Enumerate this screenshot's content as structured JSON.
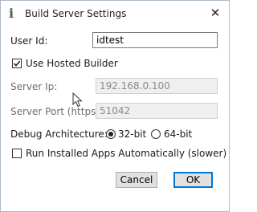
{
  "dialog": {
    "title": "Build Server Settings",
    "title_icon": "i",
    "close_glyph": "✕"
  },
  "user_id": {
    "label": "User Id:",
    "value": "idtest"
  },
  "use_hosted_builder": {
    "label": "Use Hosted Builder",
    "checked": true
  },
  "server_ip": {
    "label": "Server Ip:",
    "value": "192.168.0.100",
    "enabled": false
  },
  "server_port": {
    "label": "Server Port (https):",
    "value": "51042",
    "enabled": false
  },
  "debug_architecture": {
    "label": "Debug Architecture:",
    "options": [
      "32-bit",
      "64-bit"
    ],
    "selected": "32-bit"
  },
  "run_installed_apps": {
    "label": "Run Installed Apps Automatically (slower)",
    "checked": false
  },
  "buttons": {
    "cancel": "Cancel",
    "ok": "OK"
  },
  "colors": {
    "default_button_border": "#0078d7",
    "disabled_field_bg": "#efefef",
    "window_border": "#aeb9c8"
  }
}
